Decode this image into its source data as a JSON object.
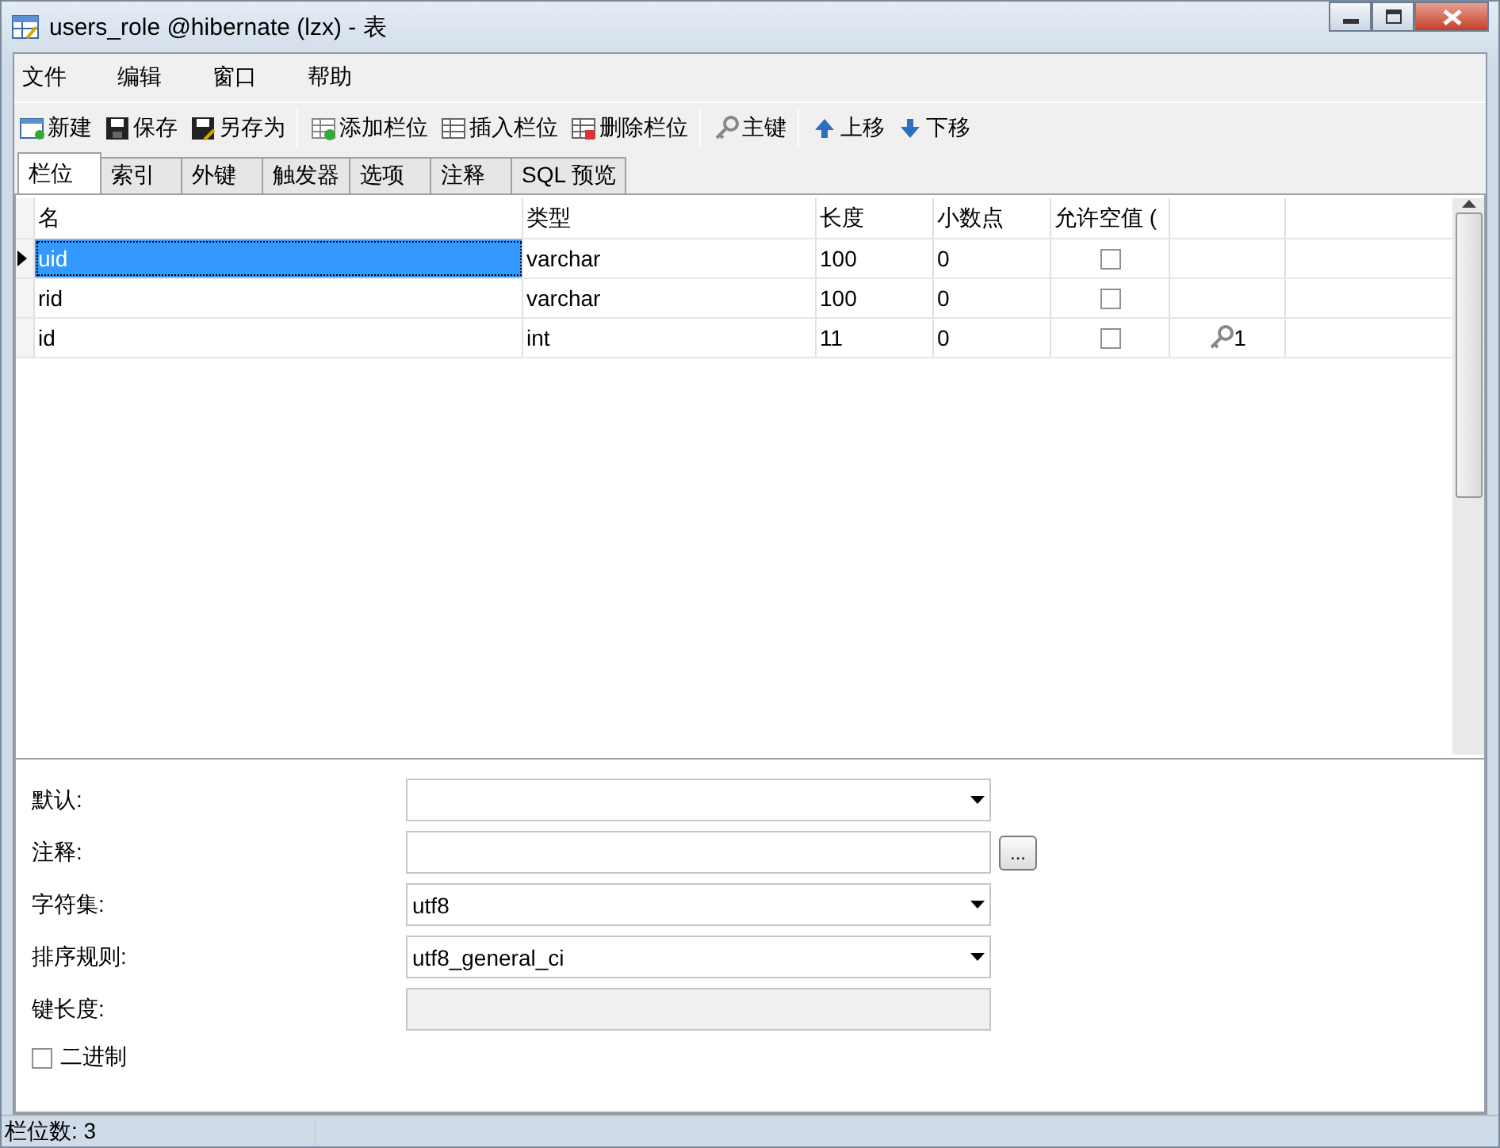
{
  "window": {
    "title": "users_role @hibernate (lzx) - 表"
  },
  "menu": [
    "文件",
    "编辑",
    "窗口",
    "帮助"
  ],
  "toolbar": [
    [
      {
        "label": "新建"
      },
      {
        "label": "保存"
      },
      {
        "label": "另存为"
      }
    ],
    [
      {
        "label": "添加栏位"
      },
      {
        "label": "插入栏位"
      },
      {
        "label": "删除栏位"
      }
    ],
    [
      {
        "label": "主键"
      }
    ],
    [
      {
        "label": "上移"
      },
      {
        "label": "下移"
      }
    ]
  ],
  "tabs": [
    {
      "label": "栏位",
      "selected": true
    },
    {
      "label": "索引",
      "selected": false
    },
    {
      "label": "外键",
      "selected": false
    },
    {
      "label": "触发器",
      "selected": false
    },
    {
      "label": "选项",
      "selected": false
    },
    {
      "label": "注释",
      "selected": false
    },
    {
      "label": "SQL 预览",
      "selected": false
    }
  ],
  "table": {
    "columns": [
      "名",
      "类型",
      "长度",
      "小数点",
      "允许空值 ("
    ],
    "rows": [
      {
        "name": "uid",
        "type": "varchar",
        "length": "100",
        "decimals": "0",
        "allow_null": false,
        "primary_key": null,
        "selected": true
      },
      {
        "name": "rid",
        "type": "varchar",
        "length": "100",
        "decimals": "0",
        "allow_null": false,
        "primary_key": null,
        "selected": false
      },
      {
        "name": "id",
        "type": "int",
        "length": "11",
        "decimals": "0",
        "allow_null": false,
        "primary_key": "1",
        "selected": false
      }
    ]
  },
  "properties": [
    {
      "label": "默认:",
      "kind": "dropdown"
    },
    {
      "label": "注释:",
      "kind": "text",
      "button": "..."
    },
    {
      "label": "字符集:",
      "kind": "dropdown",
      "value": "utf8"
    },
    {
      "label": "排序规则:",
      "kind": "dropdown",
      "value": "utf8_general_ci"
    },
    {
      "label": "键长度:",
      "kind": "disabled"
    }
  ],
  "binary": {
    "label": "二进制",
    "checked": false
  },
  "status_bar": {
    "text": "栏位数: 3"
  }
}
